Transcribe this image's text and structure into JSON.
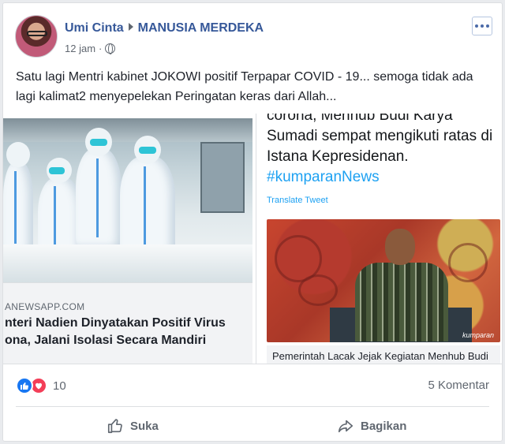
{
  "post": {
    "author": "Umi Cinta",
    "group": "MANUSIA MERDEKA",
    "time": "12 jam",
    "text": "Satu lagi Mentri kabinet JOKOWI positif Terpapar COVID - 19... semoga tidak ada lagi kalimat2 menyepelekan Peringatan keras dari Allah..."
  },
  "media": {
    "left": {
      "domain": "ANEWSAPP.COM",
      "title": "nteri Nadien Dinyatakan Positif Virus ona, Jalani Isolasi Secara Mandiri"
    },
    "right": {
      "tweet_text": "corona, Menhub Budi Karya Sumadi sempat mengikuti ratas di Istana Kepresidenan.",
      "hashtag": "#kumparanNews",
      "translate": "Translate Tweet",
      "image_watermark": "kumparan",
      "caption": "Pemerintah Lacak Jejak Kegiatan Menhub Budi"
    }
  },
  "footer": {
    "reaction_count": "10",
    "comments": "5 Komentar",
    "like_label": "Suka",
    "share_label": "Bagikan"
  },
  "icons": {
    "like": "thumbs-up-icon",
    "love": "heart-icon",
    "share": "share-arrow-icon",
    "privacy": "globe-icon",
    "more": "more-options-icon"
  },
  "colors": {
    "link_blue": "#365899",
    "twitter_blue": "#1da1f2",
    "like_blue": "#1877f2",
    "love_red": "#f33e58",
    "secondary_text": "#606770"
  }
}
